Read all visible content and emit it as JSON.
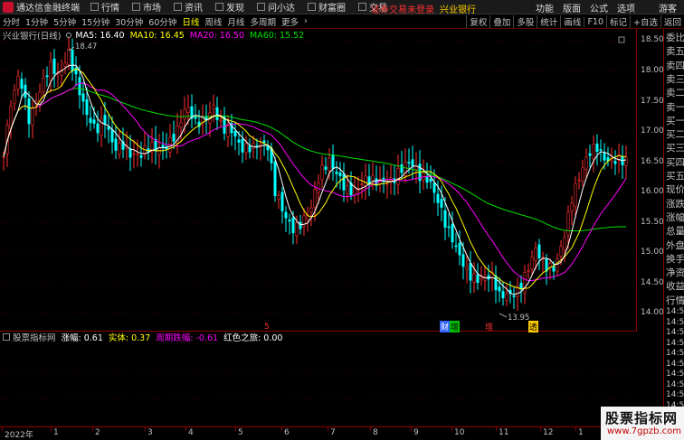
{
  "app": {
    "title": "通达信金融终端",
    "menu": [
      "行情",
      "市场",
      "资讯",
      "发现",
      "问小达",
      "财富圈",
      "交易"
    ],
    "notice": "证券交易未登录",
    "notice_stock": "兴业银行",
    "right_menu": [
      "功能",
      "版面",
      "公式",
      "选项"
    ],
    "guest": "游客"
  },
  "periods": [
    "分时",
    "1分钟",
    "5分钟",
    "15分钟",
    "30分钟",
    "60分钟",
    "日线",
    "周线",
    "月线",
    "多周期",
    "更多"
  ],
  "active_period": "日线",
  "more_caret": "›",
  "tools": [
    "复权",
    "叠加",
    "多股",
    "统计",
    "画线",
    "F10",
    "标记",
    "+自选",
    "返回"
  ],
  "chart": {
    "stock_name": "兴业银行(日线)",
    "ma5": "MA5: 16.40",
    "ma10": "MA10: 16.45",
    "ma20": "MA20: 16.50",
    "ma60": "MA60: 15.52",
    "high_mark": "18.47",
    "low_mark": "13.95",
    "colors": {
      "ma5": "#ffffff",
      "ma10": "#ffff00",
      "ma20": "#ff00ff",
      "ma60": "#00e000",
      "up": "#ff3030",
      "down": "#00ffff",
      "grid": "#8b0000"
    }
  },
  "price_labels": [
    "18.50",
    "18.00",
    "17.50",
    "17.00",
    "16.50",
    "16.00",
    "15.50",
    "15.00",
    "14.50",
    "14.00"
  ],
  "events": [
    {
      "label": "5",
      "color": "#ff3030"
    },
    {
      "label": "财",
      "color": "#3060ff"
    },
    {
      "label": "增",
      "color": "#ff3030"
    },
    {
      "label": "透",
      "color": "#ffcc00"
    },
    {
      "label": "增",
      "color": "#ff3030"
    }
  ],
  "sub": {
    "name": "股票指标网",
    "v1": "涨幅: 0.61",
    "v2": "实体: 0.37",
    "v3": "周期跌幅: -0.61",
    "v4": "红色之旅: 0.00"
  },
  "quote_panel": [
    "委比",
    "卖五",
    "卖四",
    "卖三",
    "卖二",
    "卖一",
    "买一",
    "买二",
    "买三",
    "买四",
    "买五",
    "现价",
    "涨跌",
    "涨幅",
    "总量",
    "外盘",
    "换手",
    "净资",
    "收益",
    "行情"
  ],
  "quote_times": [
    "14:56",
    "14:56",
    "14:56",
    "14:56",
    "14:56",
    "14:56",
    "14:56",
    "14:56",
    "14:56",
    "14:56",
    "14:56",
    "14:56"
  ],
  "dates": [
    "2022年",
    "1",
    "2",
    "3",
    "4",
    "5",
    "6",
    "7",
    "8",
    "9",
    "10",
    "11",
    "12",
    "1",
    "2"
  ],
  "watermark": {
    "line1": "股票指标网",
    "line2": "www.7gpzb.com"
  }
}
